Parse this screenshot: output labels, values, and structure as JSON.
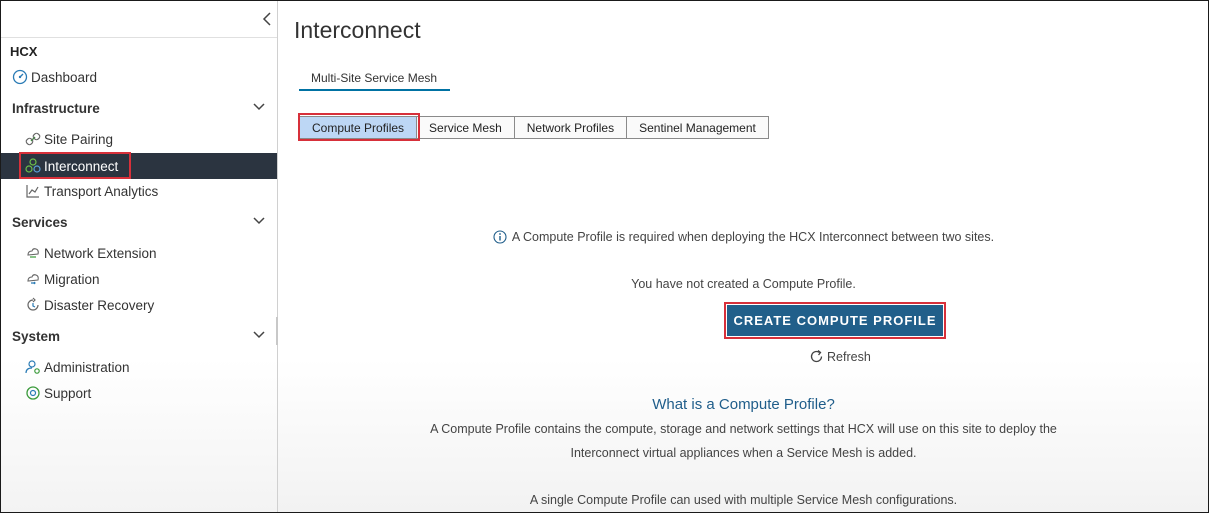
{
  "sidebar": {
    "app_title": "HCX",
    "dashboard": "Dashboard",
    "sections": {
      "infrastructure": "Infrastructure",
      "services": "Services",
      "system": "System"
    },
    "items": {
      "site_pairing": "Site Pairing",
      "interconnect": "Interconnect",
      "transport_analytics": "Transport Analytics",
      "network_extension": "Network Extension",
      "migration": "Migration",
      "disaster_recovery": "Disaster Recovery",
      "administration": "Administration",
      "support": "Support"
    }
  },
  "main": {
    "title": "Interconnect",
    "top_tab": "Multi-Site Service Mesh",
    "segments": [
      "Compute Profiles",
      "Service Mesh",
      "Network Profiles",
      "Sentinel Management"
    ],
    "selected_segment": "Compute Profiles",
    "info_text": "A Compute Profile is required when deploying the HCX Interconnect between two sites.",
    "no_profile_text": "You have not created a Compute Profile.",
    "create_button": "CREATE COMPUTE PROFILE",
    "refresh_label": "Refresh",
    "what_title": "What is a Compute Profile?",
    "description_line1": "A Compute Profile contains the compute, storage and network settings that HCX will use on this site to deploy the",
    "description_line2": "Interconnect virtual appliances when a Service Mesh is added.",
    "description_line3": "A single Compute Profile can used with multiple Service Mesh configurations."
  },
  "colors": {
    "accent": "#215f8a",
    "highlight": "#d7303a",
    "selected_segment": "#bdd7f5",
    "active_nav": "#2b3440"
  }
}
